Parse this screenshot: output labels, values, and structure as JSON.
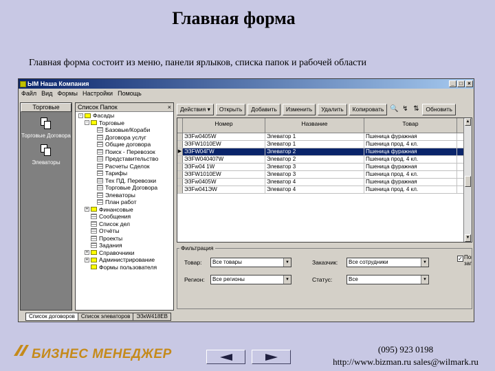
{
  "slide": {
    "title": "Главная форма",
    "subtitle": "Главная форма состоит из меню, панели ярлыков, списка папок и рабочей области"
  },
  "window": {
    "title": "ЫМ Наша Компания",
    "controls": [
      "_",
      "□",
      "×"
    ],
    "menu": [
      "Файл",
      "Вид",
      "Формы",
      "Настройки",
      "Помощь"
    ]
  },
  "shortcuts": {
    "header": "Торговые",
    "items": [
      {
        "label": "Торговые Договора",
        "icon": "documents-icon"
      },
      {
        "label": "Элеваторы",
        "icon": "documents-icon"
      }
    ]
  },
  "folders": {
    "header": "Список Папок",
    "close": "×",
    "tree": [
      {
        "label": "Фасады",
        "type": "folder",
        "exp": "-",
        "indent": 0
      },
      {
        "label": "Торговые",
        "type": "folder",
        "exp": "-",
        "indent": 1
      },
      {
        "label": "Базовые/Кораби",
        "type": "grid",
        "indent": 2
      },
      {
        "label": "Договора услуг",
        "type": "grid",
        "indent": 2
      },
      {
        "label": "Общие договора",
        "type": "grid",
        "indent": 2
      },
      {
        "label": "Поиск - Перевозок",
        "type": "grid",
        "indent": 2
      },
      {
        "label": "Представительство",
        "type": "grid",
        "indent": 2
      },
      {
        "label": "Расчеты Сделок",
        "type": "grid",
        "indent": 2
      },
      {
        "label": "Тарифы",
        "type": "grid",
        "indent": 2
      },
      {
        "label": "Тех ПД. Перевозки",
        "type": "grid",
        "indent": 2
      },
      {
        "label": "Торговые Договора",
        "type": "grid",
        "indent": 2
      },
      {
        "label": "Элеваторы",
        "type": "grid",
        "indent": 2
      },
      {
        "label": "План работ",
        "type": "grid",
        "indent": 2
      },
      {
        "label": "Финансовые",
        "type": "folder",
        "exp": "+",
        "indent": 1
      },
      {
        "label": "Сообщения",
        "type": "grid",
        "indent": 1
      },
      {
        "label": "Список дел",
        "type": "grid",
        "indent": 1
      },
      {
        "label": "Отчёты",
        "type": "grid",
        "indent": 1
      },
      {
        "label": "Проекты",
        "type": "grid",
        "indent": 1
      },
      {
        "label": "Задания",
        "type": "grid",
        "indent": 1
      },
      {
        "label": "Справочники",
        "type": "folder",
        "exp": "+",
        "indent": 1
      },
      {
        "label": "Администрирование",
        "type": "folder",
        "exp": "+",
        "indent": 1
      },
      {
        "label": "Формы пользователя",
        "type": "folder",
        "indent": 1
      }
    ]
  },
  "toolbar": {
    "buttons": [
      "Действия ▾",
      "Открыть",
      "Добавить",
      "Изменить",
      "Удалить",
      "Копировать"
    ],
    "icons": [
      "🔍",
      "↯",
      "⇅"
    ],
    "refresh": "Обновить"
  },
  "grid": {
    "columns": [
      "Номер",
      "Название",
      "Товар"
    ],
    "rows": [
      [
        "ЭЗFw0405W",
        "Элеватор 1",
        "Пшеница фуражная"
      ],
      [
        "ЭЗFW1010EW",
        "Элеватор 1",
        "Пшеница прод. 4 кл."
      ],
      [
        "ЭЗFW04ГW",
        "Элеватор 2",
        "Пшеница фуражная"
      ],
      [
        "ЭЗFW040407W",
        "Элеватор 2",
        "Пшеница прод. 4 кл."
      ],
      [
        "ЭЗFw04 1W",
        "Элеватор 3",
        "Пшеница фуражная"
      ],
      [
        "ЭЗFW1010EW",
        "Элеватор 3",
        "Пшеница прод. 4 кл."
      ],
      [
        "ЭЗFw0405W",
        "Элеватор 4",
        "Пшеница фуражная"
      ],
      [
        "ЭЗFw041ЭW",
        "Элеватор 4",
        "Пшеница прод. 4 кл."
      ]
    ],
    "selected_row": 2
  },
  "filter": {
    "legend": "Фильтрация",
    "fields": [
      {
        "label": "Товар:",
        "value": "Все товары"
      },
      {
        "label": "Регион:",
        "value": "Все регионы"
      },
      {
        "label": "Заказчик:",
        "value": "Все сотрудники"
      },
      {
        "label": "Статус:",
        "value": "Все"
      }
    ],
    "check_label": "Пок зап"
  },
  "tabs": [
    "Список договоров",
    "Список элеваторов",
    "ЭЗкW418ЕВ"
  ],
  "footer": {
    "logo": "БИЗНЕС МЕНЕДЖЕР",
    "phone": "(095) 923 0198",
    "links": "http://www.bizman.ru sales@wilmark.ru"
  }
}
